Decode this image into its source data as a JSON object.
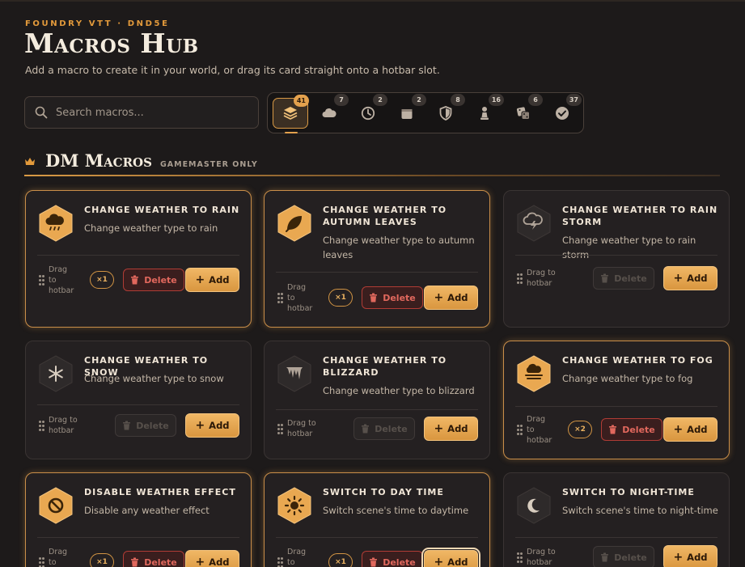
{
  "header": {
    "kicker": "FOUNDRY VTT · DND5E",
    "title": "Macros Hub",
    "subtitle": "Add a macro to create it in your world, or drag its card straight onto a hotbar slot."
  },
  "search": {
    "placeholder": "Search macros..."
  },
  "filters": [
    {
      "icon": "layers-icon",
      "count": "41",
      "active": true
    },
    {
      "icon": "cloud-icon",
      "count": "7"
    },
    {
      "icon": "clock-icon",
      "count": "2"
    },
    {
      "icon": "box-icon",
      "count": "2"
    },
    {
      "icon": "shield-icon",
      "count": "8"
    },
    {
      "icon": "pawn-icon",
      "count": "16"
    },
    {
      "icon": "dice-icon",
      "count": "6"
    },
    {
      "icon": "check-circle-icon",
      "count": "37"
    }
  ],
  "section": {
    "title": "DM Macros",
    "tag": "GAMEMASTER ONLY"
  },
  "cards": [
    {
      "title": "Change Weather to Rain",
      "desc": "Change weather type to rain",
      "owned": true,
      "count": "×1",
      "drag": "Drag to hotbar",
      "delete": "Delete",
      "add": "Add",
      "icon": "rain-cloud-icon"
    },
    {
      "title": "Change Weather to Autumn Leaves",
      "desc": "Change weather type to autumn leaves",
      "owned": true,
      "count": "×1",
      "drag": "Drag to hotbar",
      "delete": "Delete",
      "add": "Add",
      "icon": "leaf-icon"
    },
    {
      "title": "Change Weather to Rain Storm",
      "desc": "Change weather type to rain storm",
      "owned": false,
      "drag": "Drag to hotbar",
      "delete": "Delete",
      "add": "Add",
      "icon": "storm-cloud-icon"
    },
    {
      "title": "Change Weather to Snow",
      "desc": "Change weather type to snow",
      "owned": false,
      "drag": "Drag to hotbar",
      "delete": "Delete",
      "add": "Add",
      "icon": "snowflake-icon"
    },
    {
      "title": "Change Weather to Blizzard",
      "desc": "Change weather type to blizzard",
      "owned": false,
      "drag": "Drag to hotbar",
      "delete": "Delete",
      "add": "Add",
      "icon": "icicles-icon"
    },
    {
      "title": "Change Weather to Fog",
      "desc": "Change weather type to fog",
      "owned": true,
      "count": "×2",
      "drag": "Drag to hotbar",
      "delete": "Delete",
      "add": "Add",
      "icon": "fog-icon"
    },
    {
      "title": "Disable Weather Effect",
      "desc": "Disable any weather effect",
      "owned": true,
      "count": "×1",
      "drag": "Drag to hotbar",
      "delete": "Delete",
      "add": "Add",
      "icon": "prohibited-icon"
    },
    {
      "title": "Switch to Day Time",
      "desc": "Switch scene's time to daytime",
      "owned": true,
      "count": "×1",
      "drag": "Drag to hotbar",
      "delete": "Delete",
      "add": "Add",
      "icon": "sun-icon"
    },
    {
      "title": "Switch to Night-Time",
      "desc": "Switch scene's time to night-time",
      "owned": false,
      "drag": "Drag to hotbar",
      "delete": "Delete",
      "add": "Add",
      "icon": "moon-icon"
    }
  ]
}
